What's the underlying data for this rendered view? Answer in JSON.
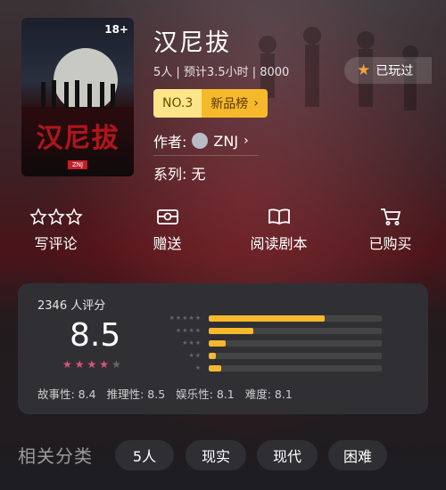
{
  "cover": {
    "age_badge": "18+",
    "title": "汉尼拔",
    "tag": "ZNJ"
  },
  "header": {
    "title": "汉尼拔",
    "meta": "5人 | 预计3.5小时 | 8000",
    "played_label": "已玩过",
    "rank_no": "NO.3",
    "rank_label": "新品榜",
    "author_prefix": "作者:",
    "author_name": "ZNJ",
    "series": "系列: 无"
  },
  "actions": [
    {
      "label": "写评论",
      "icon": "stars-icon"
    },
    {
      "label": "赠送",
      "icon": "gift-icon"
    },
    {
      "label": "阅读剧本",
      "icon": "book-icon"
    },
    {
      "label": "已购买",
      "icon": "cart-icon"
    }
  ],
  "rating": {
    "count": "2346 人评分",
    "score": "8.5",
    "stars_filled": 4,
    "stars_total": 5,
    "distribution": [
      {
        "stars": "★★★★★",
        "fraction": 0.67
      },
      {
        "stars": "★★★★",
        "fraction": 0.26
      },
      {
        "stars": "★★★",
        "fraction": 0.1
      },
      {
        "stars": "★★",
        "fraction": 0.04
      },
      {
        "stars": "★",
        "fraction": 0.07
      }
    ],
    "subscores": [
      "故事性: 8.4",
      "推理性: 8.5",
      "娱乐性: 8.1",
      "难度: 8.1"
    ]
  },
  "related": {
    "title": "相关分类",
    "tags": [
      "5人",
      "现实",
      "现代",
      "困难"
    ]
  },
  "colors": {
    "accent": "#f6b92c",
    "star_pink": "#e0507a",
    "badge_bg": "#ffe58a"
  }
}
